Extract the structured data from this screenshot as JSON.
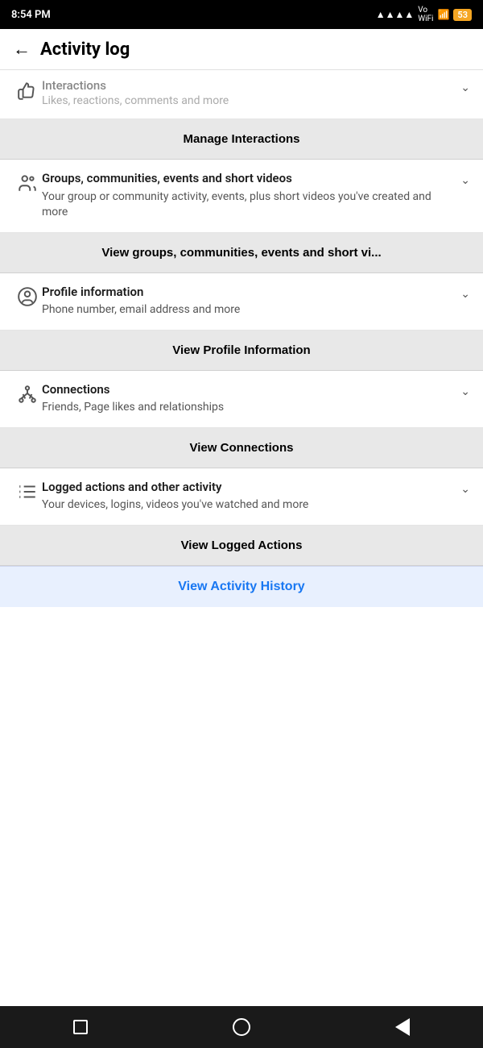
{
  "status_bar": {
    "time": "8:54 PM",
    "battery": "53"
  },
  "header": {
    "title": "Activity log",
    "back_label": "←"
  },
  "sections": [
    {
      "id": "interactions",
      "icon": "thumbs-up",
      "title": "Interactions",
      "subtitle": "Likes, reactions, comments and more",
      "button_label": "Manage Interactions",
      "truncated": true
    },
    {
      "id": "groups",
      "icon": "people-group",
      "title": "Groups, communities, events and short videos",
      "subtitle": "Your group or community activity, events, plus short videos you've created and more",
      "button_label": "View groups, communities, events and short vi..."
    },
    {
      "id": "profile",
      "icon": "person-circle",
      "title": "Profile information",
      "subtitle": "Phone number, email address and more",
      "button_label": "View Profile Information"
    },
    {
      "id": "connections",
      "icon": "connections",
      "title": "Connections",
      "subtitle": "Friends, Page likes and relationships",
      "button_label": "View Connections"
    },
    {
      "id": "logged",
      "icon": "list",
      "title": "Logged actions and other activity",
      "subtitle": "Your devices, logins, videos you've watched and more",
      "button_label": "View Logged Actions"
    }
  ],
  "activity_history": {
    "button_label": "View Activity History"
  },
  "bottom_nav": {
    "square_label": "recent-apps",
    "circle_label": "home",
    "triangle_label": "back"
  }
}
